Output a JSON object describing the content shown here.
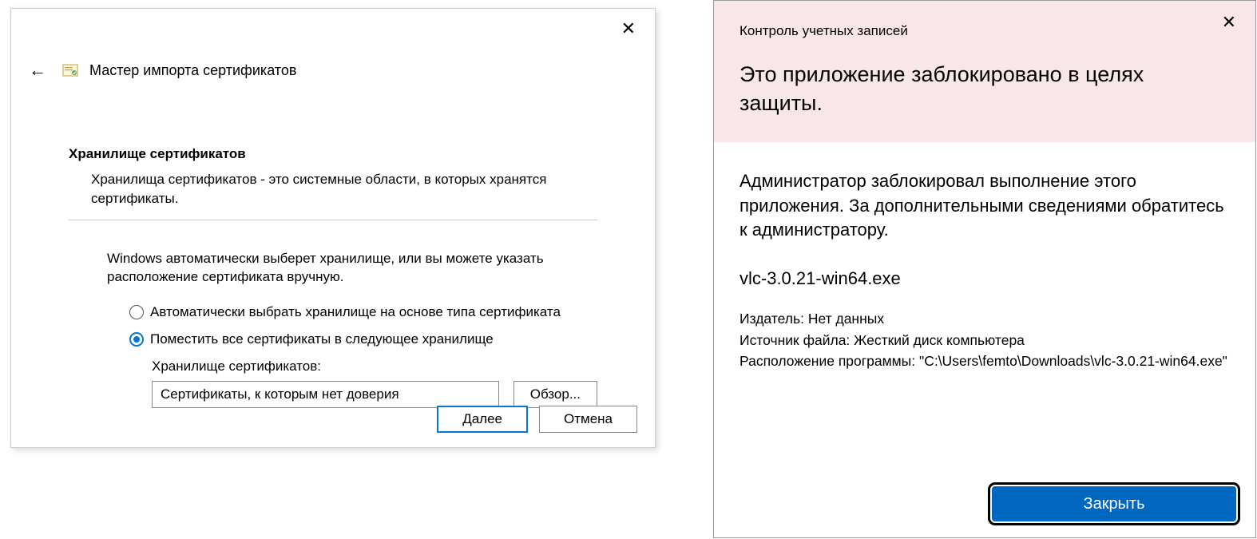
{
  "cert_wizard": {
    "title": "Мастер импорта сертификатов",
    "section_title": "Хранилище сертификатов",
    "section_desc": "Хранилища сертификатов - это системные области, в которых хранятся сертификаты.",
    "instruction": "Windows автоматически выберет хранилище, или вы можете указать расположение сертификата вручную.",
    "radio_auto": "Автоматически выбрать хранилище на основе типа сертификата",
    "radio_manual": "Поместить все сертификаты в следующее хранилище",
    "store_label": "Хранилище сертификатов:",
    "store_value": "Сертификаты, к которым нет доверия",
    "browse_label": "Обзор...",
    "next_label": "Далее",
    "cancel_label": "Отмена"
  },
  "uac": {
    "subtitle": "Контроль учетных записей",
    "title": "Это приложение заблокировано в целях защиты.",
    "message": "Администратор заблокировал выполнение этого приложения. За дополнительными сведениями обратитесь к администратору.",
    "filename": "vlc-3.0.21-win64.exe",
    "publisher_label": "Издатель:",
    "publisher_value": "Нет данных",
    "source_label": "Источник файла:",
    "source_value": "Жесткий диск компьютера",
    "location_label": "Расположение программы:",
    "location_value": "\"C:\\Users\\femto\\Downloads\\vlc-3.0.21-win64.exe\"",
    "close_label": "Закрыть"
  }
}
